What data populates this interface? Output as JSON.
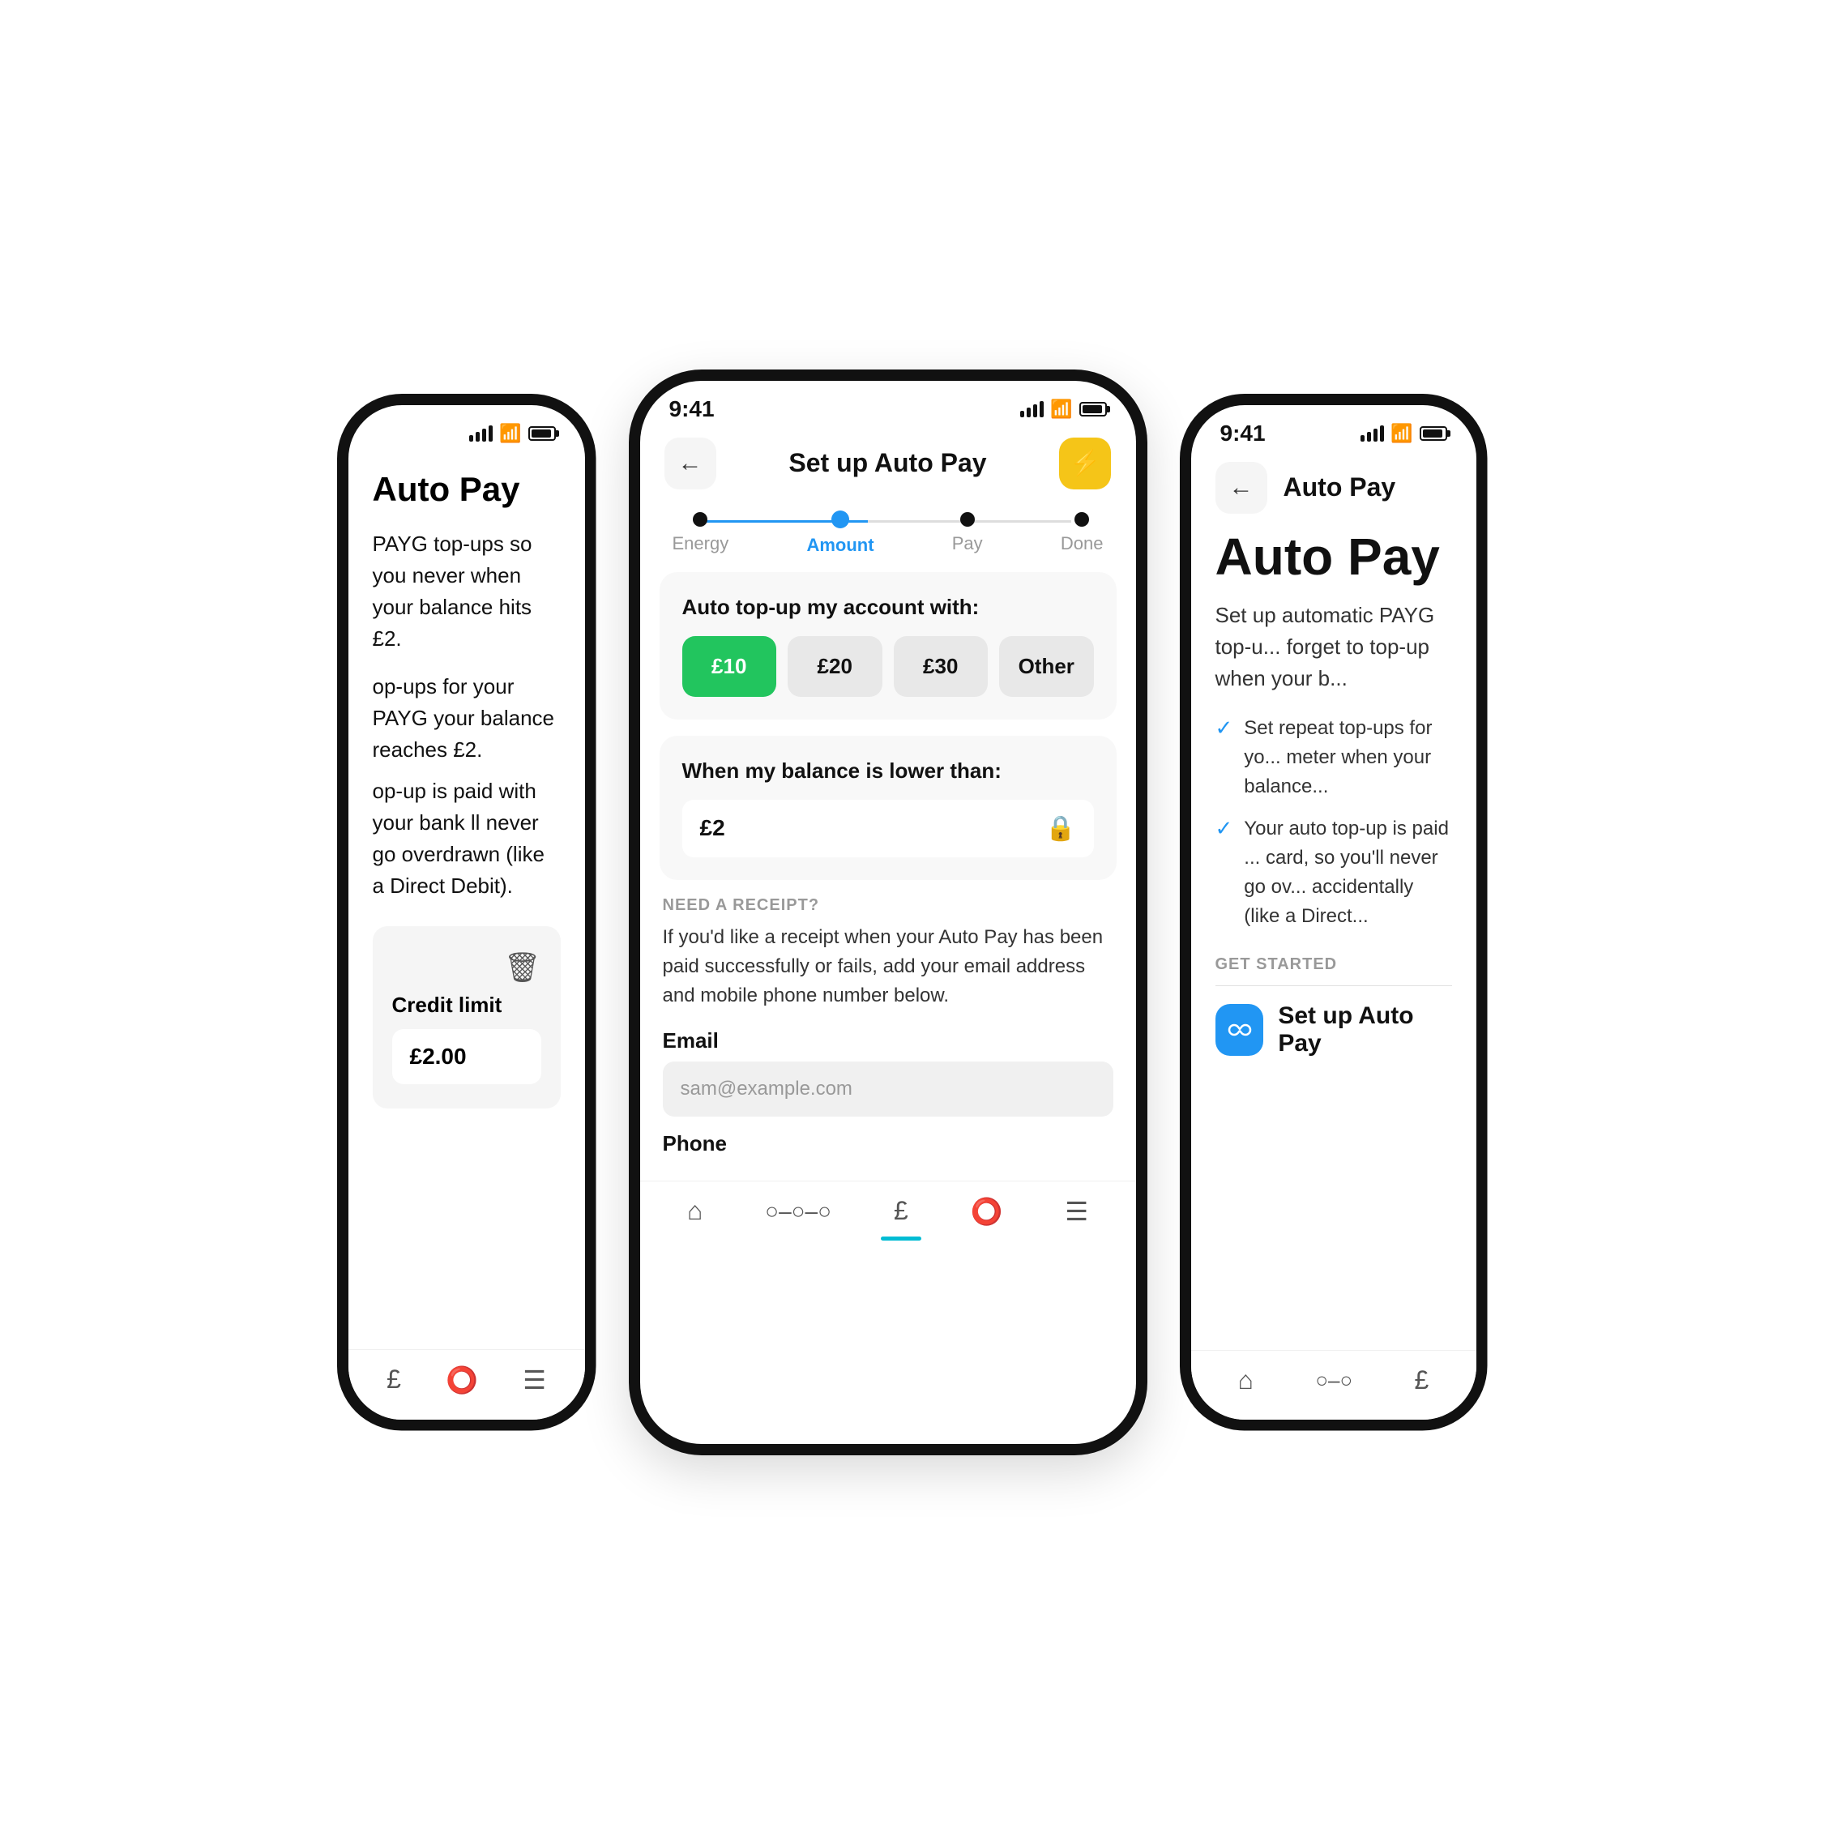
{
  "phone1": {
    "title": "Auto Pay",
    "desc1": "PAYG top-ups so you never when your balance hits £2.",
    "desc2": "op-ups for your PAYG your balance reaches £2.",
    "desc3": "op-up is paid with your bank ll never go overdrawn (like a Direct Debit).",
    "credit_label": "Credit limit",
    "credit_value": "£2.00"
  },
  "phone2": {
    "status_time": "9:41",
    "header_title": "Set up Auto Pay",
    "stepper": {
      "steps": [
        "Energy",
        "Amount",
        "Pay",
        "Done"
      ],
      "active_index": 1
    },
    "top_up_title": "Auto top-up my account with:",
    "amounts": [
      "£10",
      "£20",
      "£30",
      "Other"
    ],
    "selected_amount_index": 0,
    "balance_title": "When my balance is lower than:",
    "balance_value": "£2",
    "receipt_label": "NEED A RECEIPT?",
    "receipt_desc": "If you'd like a receipt when your Auto Pay has been paid successfully or fails, add your email address and mobile phone number below.",
    "email_label": "Email",
    "email_placeholder": "sam@example.com",
    "phone_label": "Phone"
  },
  "phone3": {
    "status_time": "9:41",
    "header_title": "Auto Pay",
    "main_title": "Auto Pay",
    "desc": "Set up automatic PAYG top-u... forget to top-up when your b...",
    "features": [
      "Set repeat top-ups for yo... meter when your balance...",
      "Your auto top-up is paid ... card, so you'll never go ov... accidentally (like a Direct..."
    ],
    "get_started_label": "GET STARTED",
    "setup_btn_label": "Set up Auto Pay"
  },
  "nav": {
    "items": [
      "home",
      "connect",
      "account",
      "help",
      "menu"
    ]
  }
}
